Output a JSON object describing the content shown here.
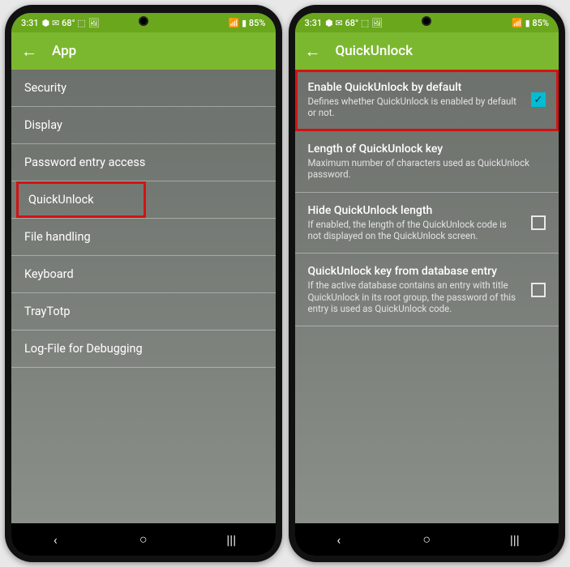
{
  "status": {
    "time": "3:31",
    "icons": "⬢ ✉ 68° ⬚ 🖼",
    "right": "📶 ▮ 85%"
  },
  "left": {
    "title": "App",
    "items": [
      {
        "label": "Security",
        "hl": false
      },
      {
        "label": "Display",
        "hl": false
      },
      {
        "label": "Password entry access",
        "hl": false
      },
      {
        "label": "QuickUnlock",
        "hl": true
      },
      {
        "label": "File handling",
        "hl": false
      },
      {
        "label": "Keyboard",
        "hl": false
      },
      {
        "label": "TrayTotp",
        "hl": false
      },
      {
        "label": "Log-File for Debugging",
        "hl": false
      }
    ]
  },
  "right": {
    "title": "QuickUnlock",
    "items": [
      {
        "title": "Enable QuickUnlock by default",
        "sub": "Defines whether QuickUnlock is enabled by default or not.",
        "checked": true,
        "hl": true
      },
      {
        "title": "Length of QuickUnlock key",
        "sub": "Maximum number of characters used as QuickUnlock password.",
        "checked": null,
        "hl": false
      },
      {
        "title": "Hide QuickUnlock length",
        "sub": "If enabled, the length of the QuickUnlock code is not displayed on the QuickUnlock screen.",
        "checked": false,
        "hl": false
      },
      {
        "title": "QuickUnlock key from database entry",
        "sub": "If the active database contains an entry with title QuickUnlock in its root group, the password of this entry is used as QuickUnlock code.",
        "checked": false,
        "hl": false
      }
    ]
  },
  "nav": {
    "back": "‹",
    "home": "○",
    "recent": "≡"
  }
}
